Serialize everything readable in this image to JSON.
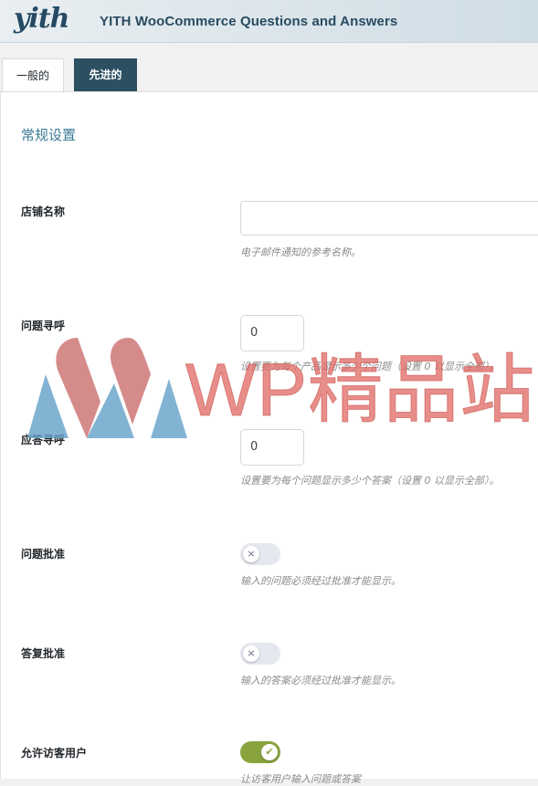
{
  "header": {
    "logo_text": "yith",
    "title": "YITH WooCommerce Questions and Answers"
  },
  "tabs": [
    {
      "label": "一般的",
      "active": true
    },
    {
      "label": "先进的",
      "active": false
    }
  ],
  "section_title": "常规设置",
  "settings": {
    "store_name": {
      "label": "店铺名称",
      "value": "",
      "description": "电子邮件通知的参考名称。"
    },
    "questions_per_page": {
      "label": "问题寻呼",
      "value": "0",
      "description": "设置要为每个产品显示多少个问题（设置 0 以显示全部）。"
    },
    "answers_per_page": {
      "label": "应答寻呼",
      "value": "0",
      "description": "设置要为每个问题显示多少个答案（设置 0 以显示全部）。"
    },
    "question_approval": {
      "label": "问题批准",
      "enabled": false,
      "description": "输入的问题必须经过批准才能显示。"
    },
    "answer_approval": {
      "label": "答复批准",
      "enabled": false,
      "description": "输入的答案必须经过批准才能显示。"
    },
    "allow_guests": {
      "label": "允许访客用户",
      "enabled": true,
      "description": "让访客用户输入问题或答案"
    }
  },
  "toggle_icons": {
    "off": "×",
    "on": "✔"
  },
  "watermark": {
    "text": "WP精品站"
  },
  "colors": {
    "accent": "#2c4f61",
    "section_title": "#3d7a93",
    "toggle_on": "#8aa43d",
    "toggle_off": "#e5e8ee"
  }
}
